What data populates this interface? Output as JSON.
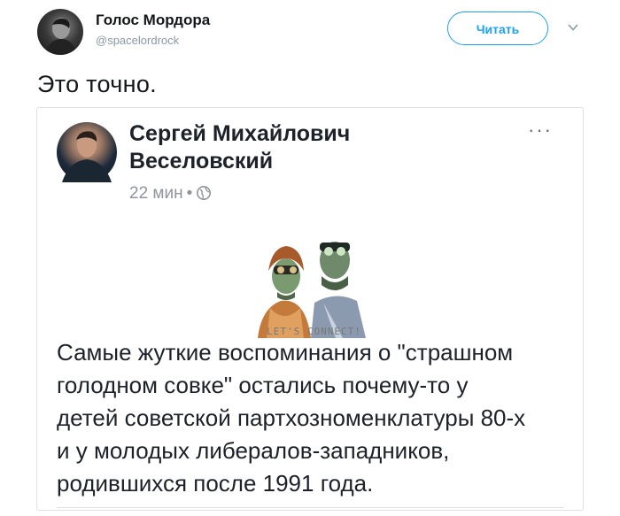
{
  "tweet": {
    "author": {
      "name": "Голос Мордора",
      "handle": "@spacelordrock"
    },
    "follow_label": "Читать",
    "text": "Это точно."
  },
  "embedded_post": {
    "author_name_line1": "Сергей Михайлович",
    "author_name_line2": "Веселовский",
    "time": "22 мин",
    "separator": "•",
    "more": "···",
    "image_caption": "LET'S CONNECT!",
    "text_lines": [
      "Самые жуткие воспоминания о \"страшном",
      "голодном совке\" остались почему-то у",
      "детей советской партхозноменклатуры 80-х",
      "и у молодых либералов-западников,",
      "родившихся после 1991 года."
    ]
  },
  "icons": {
    "chevron": "chevron-down-icon",
    "globe": "globe-icon"
  },
  "colors": {
    "accent": "#1da1f2",
    "secondary_text": "#8899a6",
    "fb_meta": "#90949c"
  }
}
